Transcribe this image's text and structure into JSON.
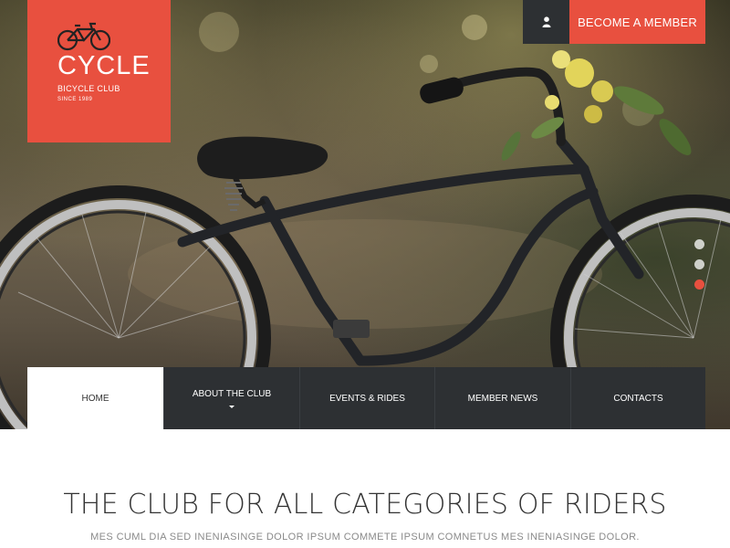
{
  "logo": {
    "title": "CYCLE",
    "subtitle": "BICYCLE CLUB",
    "since": "SINCE 1989",
    "icon": "bicycle-icon"
  },
  "header": {
    "user_icon": "user-icon",
    "member_label": "BECOME A MEMBER"
  },
  "slider": {
    "dots": 3,
    "active_index": 2
  },
  "nav": {
    "items": [
      {
        "label": "HOME",
        "active": true
      },
      {
        "label": "ABOUT THE CLUB",
        "dropdown": true
      },
      {
        "label": "EVENTS & RIDES"
      },
      {
        "label": "MEMBER NEWS"
      },
      {
        "label": "CONTACTS"
      }
    ]
  },
  "main": {
    "headline": "THE CLUB FOR ALL CATEGORIES OF RIDERS",
    "subline": "MES CUML DIA SED INENIASINGE DOLOR IPSUM COMMETE IPSUM COMNETUS MES INENIASINGE DOLOR."
  },
  "colors": {
    "accent": "#e8503f",
    "dark": "#2d3033",
    "text": "#333333",
    "muted": "#8a8a8a"
  }
}
